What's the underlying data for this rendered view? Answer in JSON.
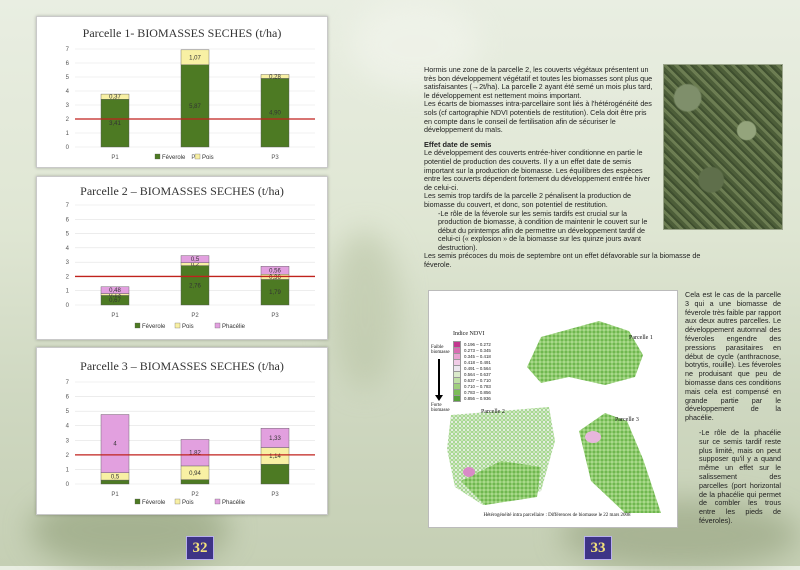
{
  "pages": {
    "left": "32",
    "right": "33"
  },
  "chart1": {
    "title": "Parcelle 1- BIOMASSES SECHES (t/ha)",
    "yticks": [
      "0",
      "1",
      "2",
      "3",
      "4",
      "5",
      "6",
      "7"
    ],
    "legend": [
      "Féverole",
      "Pois"
    ]
  },
  "chart2": {
    "title": "Parcelle 2 – BIOMASSES SECHES (t/ha)",
    "yticks": [
      "0",
      "1",
      "2",
      "3",
      "4",
      "5",
      "6",
      "7"
    ],
    "legend": [
      "Féverole",
      "Pois",
      "Phacélie"
    ]
  },
  "chart3": {
    "title": "Parcelle 3 – BIOMASSES SECHES (t/ha)",
    "yticks": [
      "0",
      "1",
      "2",
      "3",
      "4",
      "5",
      "6",
      "7"
    ],
    "legend": [
      "Féverole",
      "Pois",
      "Phacélie"
    ]
  },
  "chart_data": [
    {
      "type": "bar",
      "stacked": true,
      "title": "Parcelle 1- BIOMASSES SECHES (t/ha)",
      "categories": [
        "P1",
        "P2",
        "P3"
      ],
      "ylim": [
        0,
        7
      ],
      "reference_line": 2,
      "series": [
        {
          "name": "Féverole",
          "values": [
            3.41,
            5.87,
            4.9
          ]
        },
        {
          "name": "Pois",
          "values": [
            0.37,
            1.07,
            0.28
          ]
        }
      ],
      "labels": [
        [
          "3,41",
          "0,37"
        ],
        [
          "5,87",
          "1,07"
        ],
        [
          "4,90",
          "0,28"
        ]
      ]
    },
    {
      "type": "bar",
      "stacked": true,
      "title": "Parcelle 2 – BIOMASSES SECHES (t/ha)",
      "categories": [
        "P1",
        "P2",
        "P3"
      ],
      "ylim": [
        0,
        7
      ],
      "reference_line": 2,
      "series": [
        {
          "name": "Féverole",
          "values": [
            0.67,
            2.76,
            1.79
          ]
        },
        {
          "name": "Pois",
          "values": [
            0.13,
            0.2,
            0.36
          ]
        },
        {
          "name": "Phacélie",
          "values": [
            0.48,
            0.5,
            0.56
          ]
        }
      ],
      "labels": [
        [
          "0,67",
          "0,13",
          "0,48"
        ],
        [
          "2,76",
          "0,2",
          "0,5"
        ],
        [
          "1,79",
          "0,36",
          "0,56"
        ]
      ]
    },
    {
      "type": "bar",
      "stacked": true,
      "title": "Parcelle 3 – BIOMASSES SECHES (t/ha)",
      "categories": [
        "P1",
        "P2",
        "P3"
      ],
      "ylim": [
        0,
        7
      ],
      "reference_line": 2,
      "series": [
        {
          "name": "Féverole",
          "values": [
            0.27,
            0.3,
            1.36
          ]
        },
        {
          "name": "Pois",
          "values": [
            0.5,
            0.94,
            1.14
          ]
        },
        {
          "name": "Phacélie",
          "values": [
            4,
            1.82,
            1.33
          ]
        }
      ],
      "labels": [
        [
          "",
          "0,5",
          "4"
        ],
        [
          "",
          "0,94",
          "1,82"
        ],
        [
          "",
          "1,14",
          "1,33"
        ]
      ]
    }
  ],
  "colors": {
    "feverole": "#4d7a23",
    "pois": "#f8f0a4",
    "phacelie": "#e2a0df",
    "refline": "#c0221d"
  },
  "text": {
    "p1": "Hormis une zone de la parcelle 2, les couverts végétaux présentent un très bon développement végétatif et toutes les biomasses sont plus que satisfaisantes (→2t/ha). La parcelle 2 ayant été semé un mois plus tard, le développement est nettement moins important.",
    "p2": "Les écarts de biomasses intra-parcellaire sont liés à l'hétérogénéité des sols (cf cartographie NDVI potentiels de restitution). Cela doit être pris en compte dans le conseil de fertilisation afin de sécuriser le développement du maïs.",
    "h_semis": "Effet date de semis",
    "p3": "Le développement des couverts entrée-hiver conditionne en partie le potentiel de production des couverts. Il y a un effet date de semis important sur la production de biomasse. Les équilibres des espèces entre les couverts dépendent fortement du développement entrée hiver de celui-ci.",
    "p4": "Les semis trop tardifs de la parcelle 2 pénalisent la production de biomasse du couvert, et donc, son potentiel de restitution.",
    "p5": "-Le rôle de la féverole sur les semis tardifs est crucial sur la production de biomasse, à condition de maintenir le couvert sur le début du printemps afin de permettre un développement tardif de celui-ci (« explosion » de la biomasse sur les quinze jours avant destruction).",
    "p6": "Les semis précoces du mois de septembre ont un effet défavorable sur la biomasse de féverole.",
    "side1": "Cela est le cas de la parcelle 3 qui a une biomasse de féverole très faible par rapport aux deux autres parcelles. Le développement automnal des féveroles engendre des pressions parasitaires en début de cycle (anthracnose, botrytis, rouille). Les féveroles ne produisant que peu de biomasse dans ces conditions mais cela est compensé en grande partie par le développement de la phacélie.",
    "side2": "-Le rôle de la phacélie sur ce semis tardif reste plus limité, mais on peut supposer qu'il y a quand même un effet sur le salissement des parcelles (port horizontal de la phacélie qui permet de combler les trous entre les pieds de féveroles)."
  },
  "map": {
    "legend_title": "Indice NDVI",
    "faible": "Faible biomasse",
    "forte": "Forte biomasse",
    "ranges": [
      "0.196 – 0.272",
      "0.273 – 0.345",
      "0.345 – 0.418",
      "0.418 – 0.491",
      "0.491 – 0.564",
      "0.564 – 0.637",
      "0.637 – 0.710",
      "0.710 – 0.783",
      "0.783 – 0.856",
      "0.856 – 0.936"
    ],
    "range_colors": [
      "#c2378e",
      "#d86db2",
      "#e8a3d1",
      "#f1cce6",
      "#ece7ee",
      "#dbeacb",
      "#bfe0a4",
      "#9fcf7c",
      "#7cbc58",
      "#56a03a"
    ],
    "p1": "Parcelle 1",
    "p2": "Parcelle 2",
    "p3": "Parcelle 3",
    "caption": "Hétérogénéité intra parcellaire : Différences de biomasse le 22 mars 2008"
  }
}
